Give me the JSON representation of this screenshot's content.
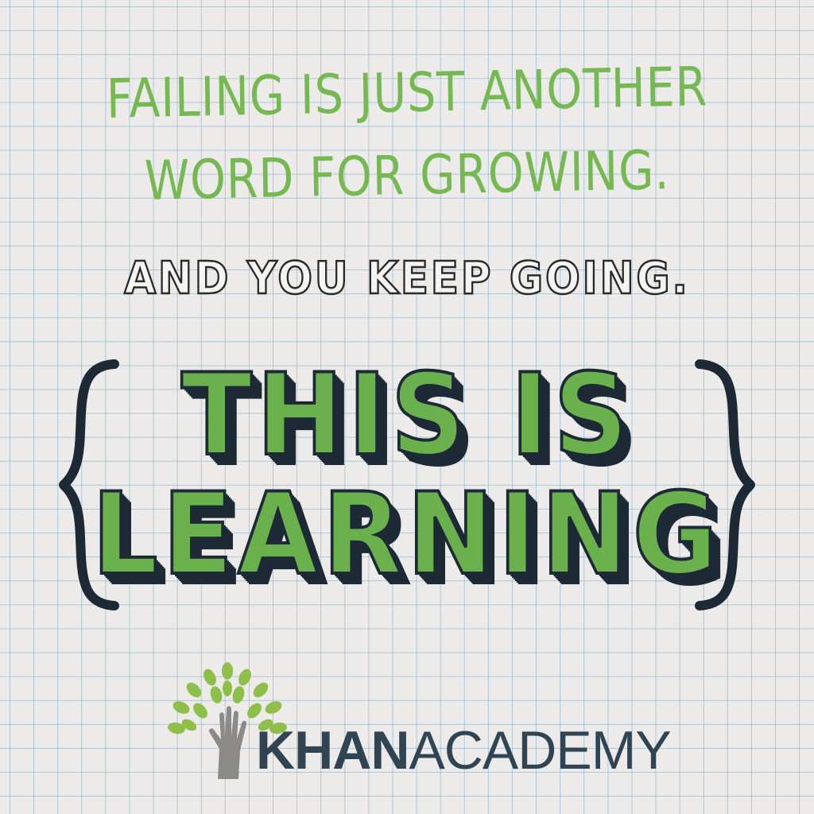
{
  "tagline": {
    "line_1": "FAILING IS JUST ANOTHER",
    "line_2": "WORD FOR GROWING.",
    "line_3": "AND YOU KEEP GOING."
  },
  "headline": {
    "line_1": "THIS IS",
    "line_2": "LEARNING"
  },
  "logo": {
    "icon": "tree-hand-icon",
    "brand_strong": "KHAN",
    "brand_light": "ACADEMY"
  },
  "colors": {
    "green": "#76b852",
    "dark_navy": "#1d2a36",
    "paper": "#ecebea",
    "grid": "#78aac8",
    "brand_text": "#314453"
  }
}
